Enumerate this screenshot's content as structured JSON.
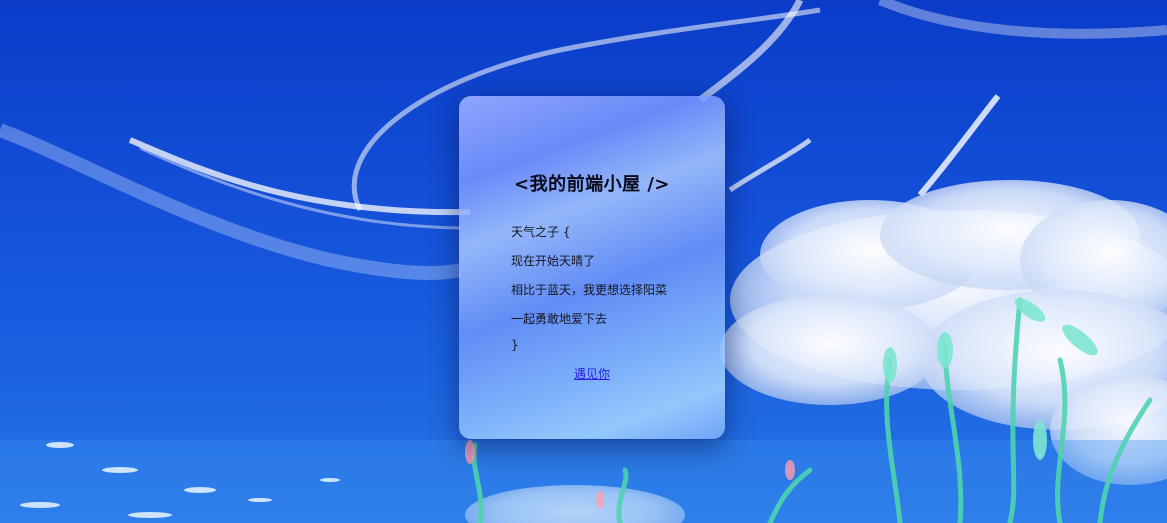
{
  "card": {
    "title": "<我的前端小屋 />",
    "lines": [
      "天气之子 {",
      "现在开始天晴了",
      "相比于蓝天，我更想选择阳菜",
      "一起勇敢地爱下去",
      "}"
    ],
    "link_label": "遇见你"
  },
  "colors": {
    "sky": "#1450d8",
    "card_tint": "#8ea8ff",
    "link": "#2a1ee8"
  }
}
